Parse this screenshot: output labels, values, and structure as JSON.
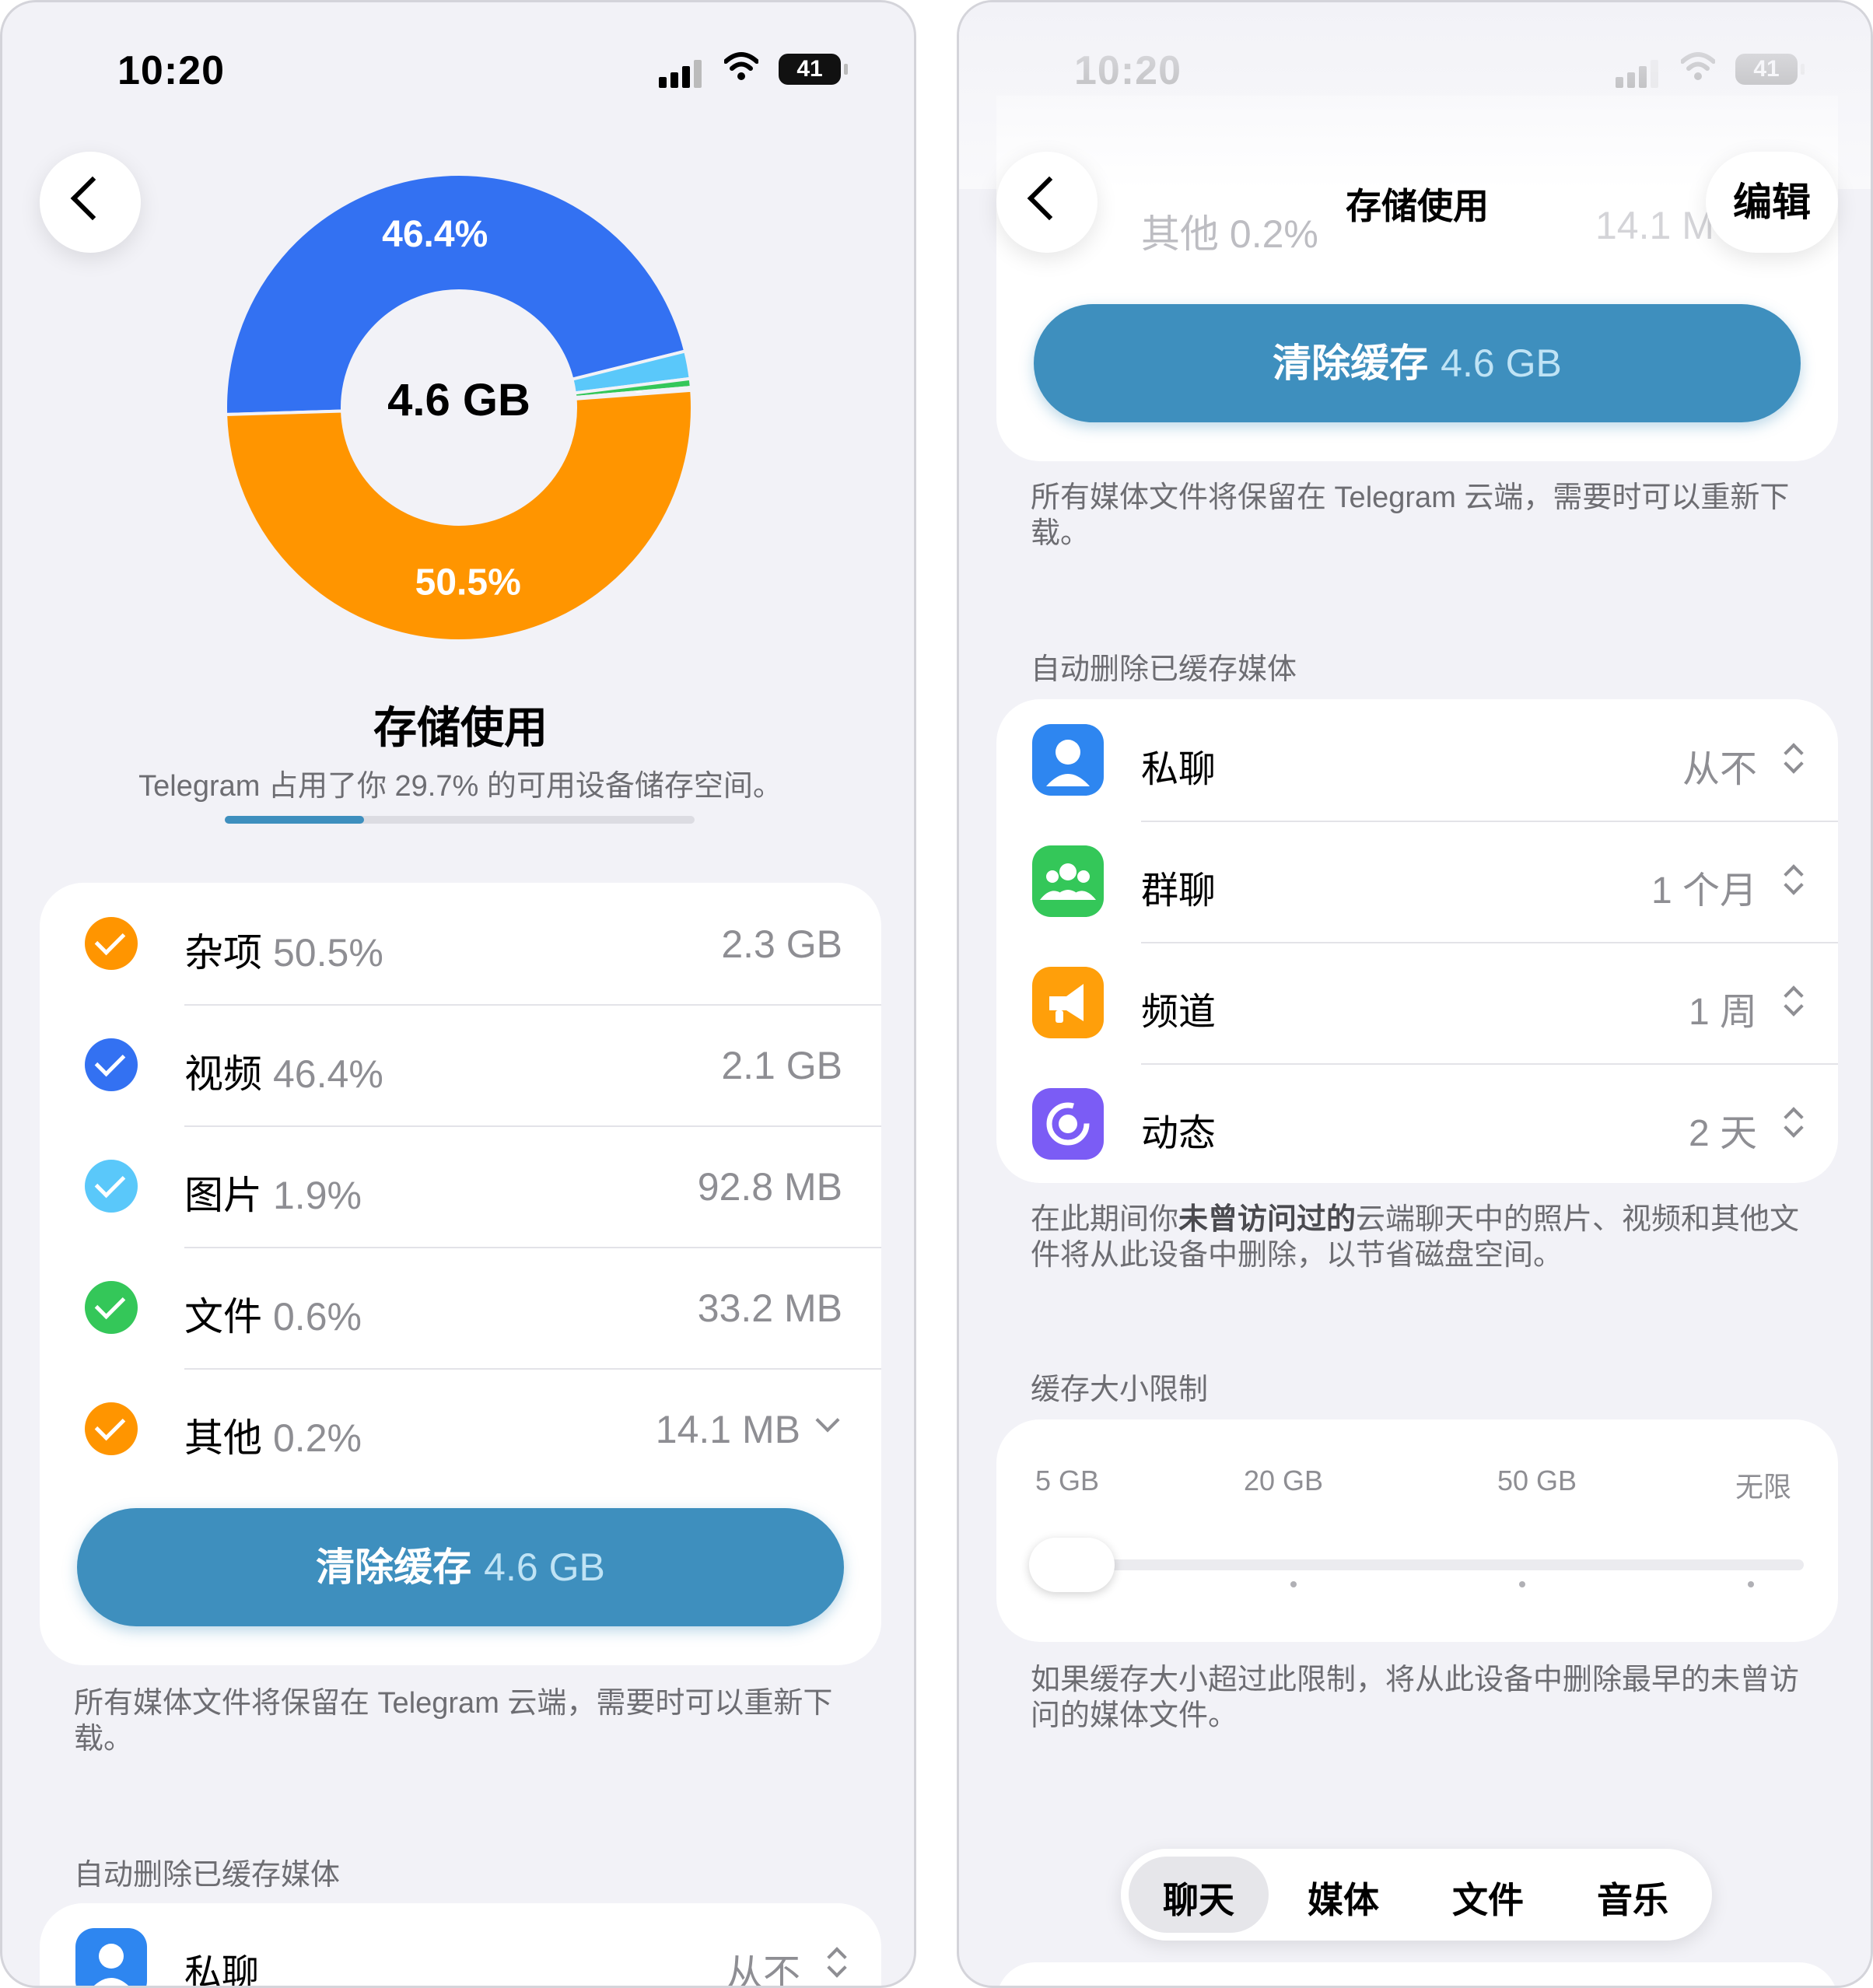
{
  "status": {
    "time": "10:20",
    "battery": "41"
  },
  "left": {
    "chart_data": {
      "type": "pie",
      "center_label": "4.6 GB",
      "slices": [
        {
          "label": "视频",
          "value": 46.4,
          "color": "#3371f2",
          "display": "46.4%"
        },
        {
          "label": "图片",
          "value": 1.9,
          "color": "#5ac8fa",
          "display": ""
        },
        {
          "label": "文件",
          "value": 0.6,
          "color": "#34c759",
          "display": ""
        },
        {
          "label": "其他",
          "value": 0.2,
          "color": "#ff9500",
          "display": "0.2%"
        },
        {
          "label": "杂项",
          "value": 50.5,
          "color": "#ff9500",
          "display": "50.5%"
        }
      ]
    },
    "title": "存储使用",
    "subtitle": "Telegram 占用了你 29.7% 的可用设备储存空间。",
    "usage_fraction": 0.297,
    "categories": [
      {
        "name": "杂项",
        "pct": "50.5%",
        "size": "2.3 GB",
        "color": "#ff9500"
      },
      {
        "name": "视频",
        "pct": "46.4%",
        "size": "2.1 GB",
        "color": "#3371f2"
      },
      {
        "name": "图片",
        "pct": "1.9%",
        "size": "92.8 MB",
        "color": "#5ac8fa"
      },
      {
        "name": "文件",
        "pct": "0.6%",
        "size": "33.2 MB",
        "color": "#34c759"
      },
      {
        "name": "其他",
        "pct": "0.2%",
        "size": "14.1 MB",
        "color": "#ff9500"
      }
    ],
    "clear_label": "清除缓存",
    "clear_size": "4.6 GB",
    "footnote": "所有媒体文件将保留在 Telegram 云端，需要时可以重新下载。",
    "auto_delete_header": "自动删除已缓存媒体",
    "partial_row": {
      "label": "私聊",
      "value": "从不"
    }
  },
  "right": {
    "nav_title": "存储使用",
    "edit_label": "编辑",
    "peek_label": "其他",
    "peek_pct": "0.2%",
    "peek_size": "14.1 M",
    "clear_label": "清除缓存",
    "clear_size": "4.6 GB",
    "footnote": "所有媒体文件将保留在 Telegram 云端，需要时可以重新下载。",
    "auto_delete_header": "自动删除已缓存媒体",
    "auto_delete": [
      {
        "label": "私聊",
        "value": "从不",
        "icon": "person-icon",
        "color": "#2e86f0"
      },
      {
        "label": "群聊",
        "value": "1 个月",
        "icon": "group-icon",
        "color": "#34c759"
      },
      {
        "label": "频道",
        "value": "1 周",
        "icon": "megaphone-icon",
        "color": "#ff9f0a"
      },
      {
        "label": "动态",
        "value": "2 天",
        "icon": "stories-icon",
        "color": "#7b5cf5"
      }
    ],
    "auto_delete_note_pre": "在此期间你",
    "auto_delete_note_bold": "未曾访问过的",
    "auto_delete_note_post": "云端聊天中的照片、视频和其他文件将从此设备中删除，以节省磁盘空间。",
    "cache_limit_header": "缓存大小限制",
    "cache_limit_ticks": [
      "5 GB",
      "20 GB",
      "50 GB",
      "无限"
    ],
    "cache_limit_selected": "5 GB",
    "cache_limit_note": "如果缓存大小超过此限制，将从此设备中删除最早的未曾访问的媒体文件。",
    "tabs": [
      "聊天",
      "媒体",
      "文件",
      "音乐"
    ],
    "active_tab": "聊天"
  }
}
